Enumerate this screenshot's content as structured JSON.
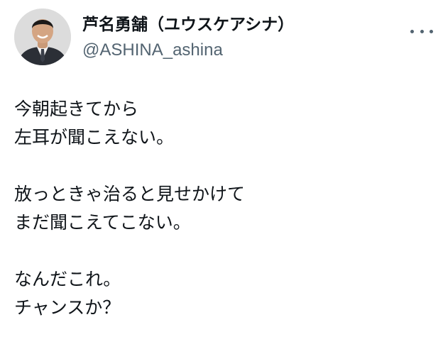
{
  "author": {
    "display_name": "芦名勇舗（ユウスケアシナ）",
    "handle": "@ASHINA_ashina",
    "avatar_icon": "profile-photo-icon"
  },
  "menu": {
    "more_icon": "more-horizontal-icon"
  },
  "tweet": {
    "lines": [
      "今朝起きてから",
      "左耳が聞こえない。",
      "",
      "放っときゃ治ると見せかけて",
      "まだ聞こえてこない。",
      "",
      "なんだこれ。",
      "チャンスか？"
    ]
  }
}
